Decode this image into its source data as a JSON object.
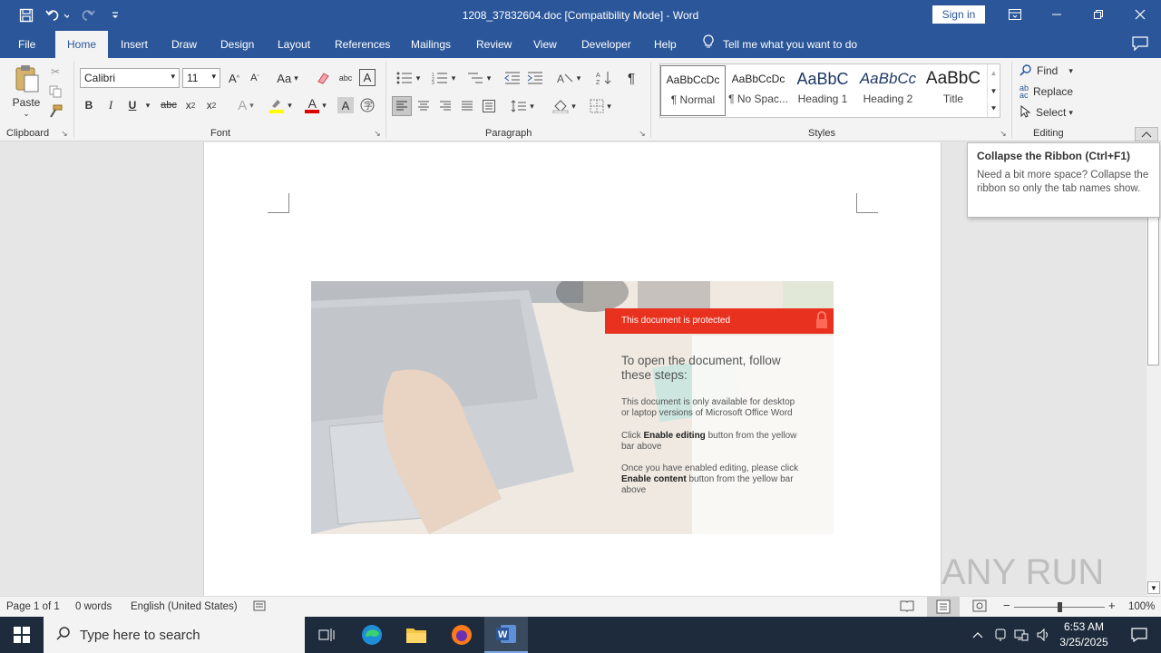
{
  "window": {
    "title": "1208_37832604.doc [Compatibility Mode]  -  Word",
    "sign_in": "Sign in",
    "colors": {
      "titlebar": "#2b579a",
      "ribbon": "#f3f3f3",
      "taskbar": "#1e2b3c"
    }
  },
  "tabs": [
    "File",
    "Home",
    "Insert",
    "Draw",
    "Design",
    "Layout",
    "References",
    "Mailings",
    "Review",
    "View",
    "Developer",
    "Help"
  ],
  "active_tab": "Home",
  "tell_me": "Tell me what you want to do",
  "ribbon": {
    "clipboard": {
      "paste": "Paste",
      "label": "Clipboard"
    },
    "font": {
      "name": "Calibri",
      "size": "11",
      "label": "Font",
      "grow": "A",
      "shrink": "A",
      "case": "Aa",
      "bold": "B",
      "italic": "I",
      "underline": "U",
      "strike": "abc",
      "subscript": "x",
      "superscript": "x",
      "sub_mark": "2",
      "sup_mark": "2",
      "effects": "A",
      "color": "A",
      "shading": "A",
      "phonetic": "abc"
    },
    "paragraph": {
      "label": "Paragraph",
      "pilcrow": "¶"
    },
    "styles": {
      "label": "Styles",
      "items": [
        {
          "sample": "AaBbCcDc",
          "name": "¶ Normal"
        },
        {
          "sample": "AaBbCcDc",
          "name": "¶ No Spac..."
        },
        {
          "sample": "AaBbC",
          "name": "Heading 1"
        },
        {
          "sample": "AaBbCc",
          "name": "Heading 2"
        },
        {
          "sample": "AaBbC",
          "name": "Title"
        }
      ]
    },
    "editing": {
      "find": "Find",
      "replace": "Replace",
      "select": "Select",
      "label": "Editing"
    }
  },
  "tooltip": {
    "title": "Collapse the Ribbon (Ctrl+F1)",
    "body": "Need a bit more space? Collapse the ribbon so only the tab names show."
  },
  "embedded_image": {
    "banner": "This document is protected",
    "heading": "To open the document, follow these steps:",
    "step1": "This document is only available for desktop or laptop versions of Microsoft Office Word",
    "step2_pre": "Click ",
    "step2_bold": "Enable editing",
    "step2_post": " button from the yellow bar above",
    "step3_pre": "Once you have enabled editing, please click ",
    "step3_bold": "Enable content",
    "step3_post": " button from the yellow bar above",
    "colors": {
      "banner": "#e8321f"
    }
  },
  "status": {
    "page": "Page 1 of 1",
    "words": "0 words",
    "language": "English (United States)",
    "zoom": "100%"
  },
  "taskbar": {
    "search_placeholder": "Type here to search",
    "time": "6:53 AM",
    "date": "3/25/2025"
  },
  "watermark": "ANY RUN"
}
